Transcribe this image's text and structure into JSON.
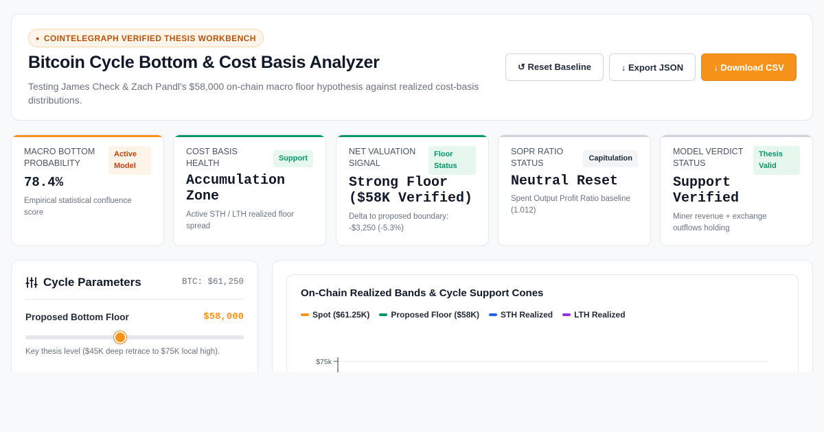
{
  "header": {
    "badge": "COINTELEGRAPH VERIFIED THESIS WORKBENCH",
    "title": "Bitcoin Cycle Bottom & Cost Basis Analyzer",
    "subtitle": "Testing James Check & Zach Pandl's $58,000 on-chain macro floor hypothesis against realized cost-basis distributions.",
    "buttons": {
      "reset": "↺ Reset Baseline",
      "export": "↓ Export JSON",
      "csv": "↓ Download CSV"
    }
  },
  "metrics": [
    {
      "label": "MACRO BOTTOM PROBABILITY",
      "tag": "Active Model",
      "value": "78.4%",
      "desc": "Empirical statistical confluence score",
      "accent": "#f7931a"
    },
    {
      "label": "COST BASIS HEALTH",
      "tag": "Support",
      "value": "Accumulation Zone",
      "desc": "Active STH / LTH realized floor spread",
      "accent": "#059669"
    },
    {
      "label": "NET VALUATION SIGNAL",
      "tag": "Floor Status",
      "value": "Strong Floor ($58K Verified)",
      "desc": "Delta to proposed boundary: -$3,250 (-5.3%)",
      "accent": "#059669"
    },
    {
      "label": "SOPR RATIO STATUS",
      "tag": "Capitulation",
      "value": "Neutral Reset",
      "desc": "Spent Output Profit Ratio baseline (1.012)",
      "accent": "#d1d5db"
    },
    {
      "label": "MODEL VERDICT STATUS",
      "tag": "Thesis Valid",
      "value": "Support Verified",
      "desc": "Miner revenue + exchange outflows holding",
      "accent": "#d1d5db"
    }
  ],
  "params": {
    "title": "Cycle Parameters",
    "btc_price": "BTC: $61,250",
    "floor_label": "Proposed Bottom Floor",
    "floor_value": "$58,000",
    "floor_fraction": 0.433,
    "hint": "Key thesis level ($45K deep retrace to $75K local high)."
  },
  "chart": {
    "title": "On-Chain Realized Bands & Cycle Support Cones",
    "legend": [
      {
        "label": "Spot ($61.25K)",
        "color": "#f7931a"
      },
      {
        "label": "Proposed Floor ($58K)",
        "color": "#059669"
      },
      {
        "label": "STH Realized",
        "color": "#2563eb"
      },
      {
        "label": "LTH Realized",
        "color": "#9333ea"
      }
    ]
  },
  "chart_data": {
    "type": "line",
    "title": "On-Chain Realized Bands & Cycle Support Cones",
    "y_ticks": [
      "$75k"
    ],
    "series": [
      {
        "name": "Spot ($61.25K)",
        "values": []
      },
      {
        "name": "Proposed Floor ($58K)",
        "values": []
      },
      {
        "name": "STH Realized",
        "values": []
      },
      {
        "name": "LTH Realized",
        "values": []
      }
    ]
  }
}
